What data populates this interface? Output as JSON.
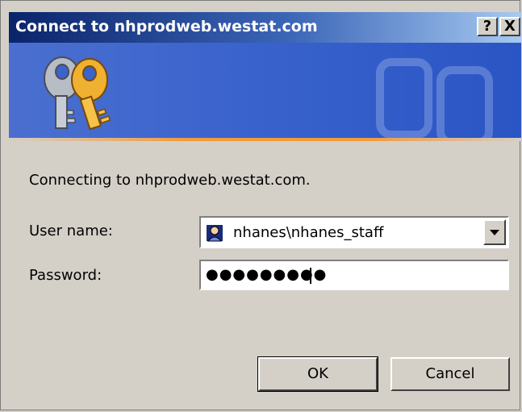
{
  "window": {
    "title": "Connect to nhprodweb.westat.com",
    "help_button": "?",
    "close_button": "X"
  },
  "banner": {
    "icon": "keys-icon",
    "accent_color": "#f29a3c",
    "gradient_colors": [
      "#4a6fd0",
      "#2a55c4"
    ]
  },
  "message": "Connecting to nhprodweb.westat.com.",
  "form": {
    "username_label": "User name:",
    "username_value": "nhanes\\nhanes_staff",
    "password_label": "Password:",
    "password_value": "●●●●●●●●●"
  },
  "buttons": {
    "ok": "OK",
    "cancel": "Cancel"
  }
}
